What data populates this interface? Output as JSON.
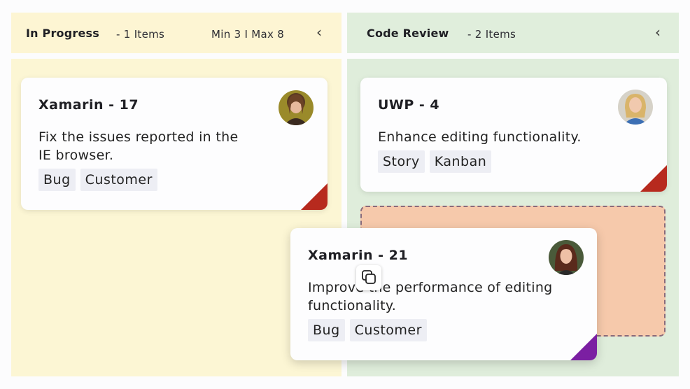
{
  "columns": [
    {
      "title": "In Progress",
      "count": "- 1 Items",
      "limit": "Min 3 I Max 8",
      "collapse_glyph": "‹"
    },
    {
      "title": "Code Review",
      "count": "- 2 Items",
      "collapse_glyph": "‹"
    }
  ],
  "cards": [
    {
      "title": "Xamarin - 17",
      "desc_line1": "Fix the issues reported in the",
      "desc_line2": "IE browser.",
      "tags": [
        "Bug",
        "Customer"
      ],
      "priority_color": "#b72a1e"
    },
    {
      "title": "UWP - 4",
      "desc_line1": "Enhance editing functionality.",
      "tags": [
        "Story",
        "Kanban"
      ],
      "priority_color": "#b72a1e"
    },
    {
      "title": "Xamarin - 21",
      "desc_line1": "Improve the performance of editing",
      "desc_line2": "functionality.",
      "tags": [
        "Bug",
        "Customer"
      ],
      "priority_color": "#7b1fa2"
    }
  ],
  "drag_icon": "copy-icon",
  "colors": {
    "in_progress_bg": "#fcf6d4",
    "code_review_bg": "#dfeddb",
    "drop_placeholder": "#f6c9ab"
  }
}
